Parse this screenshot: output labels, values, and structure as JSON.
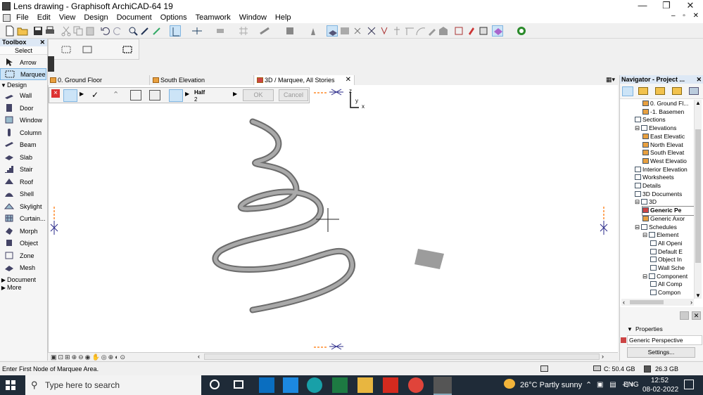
{
  "window": {
    "title": "Lens drawing - Graphisoft ArchiCAD-64 19",
    "controls": {
      "minimize": "—",
      "maximize": "❐",
      "close": "✕"
    }
  },
  "menu": [
    "File",
    "Edit",
    "View",
    "Design",
    "Document",
    "Options",
    "Teamwork",
    "Window",
    "Help"
  ],
  "toolbox": {
    "title": "Toolbox",
    "close": "✕",
    "select_label": "Select",
    "tools_top": [
      {
        "label": "Arrow",
        "icon": "arrow-icon"
      },
      {
        "label": "Marquee",
        "icon": "marquee-icon",
        "selected": true
      }
    ],
    "design_group": "Design",
    "design_tools": [
      {
        "label": "Wall",
        "icon": "wall-icon"
      },
      {
        "label": "Door",
        "icon": "door-icon"
      },
      {
        "label": "Window",
        "icon": "window-icon"
      },
      {
        "label": "Column",
        "icon": "column-icon"
      },
      {
        "label": "Beam",
        "icon": "beam-icon"
      },
      {
        "label": "Slab",
        "icon": "slab-icon"
      },
      {
        "label": "Stair",
        "icon": "stair-icon"
      },
      {
        "label": "Roof",
        "icon": "roof-icon"
      },
      {
        "label": "Shell",
        "icon": "shell-icon"
      },
      {
        "label": "Skylight",
        "icon": "skylight-icon"
      },
      {
        "label": "Curtain...",
        "icon": "curtain-wall-icon"
      },
      {
        "label": "Morph",
        "icon": "morph-icon"
      },
      {
        "label": "Object",
        "icon": "object-icon"
      },
      {
        "label": "Zone",
        "icon": "zone-icon"
      },
      {
        "label": "Mesh",
        "icon": "mesh-icon"
      }
    ],
    "document_group": "Document",
    "more_group": "More"
  },
  "tabs": [
    {
      "label": "0. Ground Floor"
    },
    {
      "label": "South Elevation"
    },
    {
      "label": "3D / Marquee, All Stories",
      "active": true,
      "close": "✕"
    }
  ],
  "marquee_bar": {
    "close": "×",
    "half_label": "Half",
    "half_value": "2",
    "ok_label": "OK",
    "cancel_label": "Cancel"
  },
  "axes": {
    "z": "z",
    "y": "y",
    "x": "x"
  },
  "navigator": {
    "title": "Navigator - Project ...",
    "close": "✕",
    "items": [
      {
        "label": "0. Ground Fl...",
        "indent": 2,
        "icon": "story-icon"
      },
      {
        "label": "-1. Basemen",
        "indent": 2,
        "icon": "story-icon"
      },
      {
        "label": "Sections",
        "indent": 1,
        "icon": "section-icon"
      },
      {
        "label": "Elevations",
        "indent": 1,
        "icon": "elevation-icon",
        "expander": "⊟"
      },
      {
        "label": "East Elevatic",
        "indent": 2,
        "icon": "house-icon"
      },
      {
        "label": "North Elevat",
        "indent": 2,
        "icon": "house-icon"
      },
      {
        "label": "South Elevat",
        "indent": 2,
        "icon": "house-icon"
      },
      {
        "label": "West Elevatio",
        "indent": 2,
        "icon": "house-icon"
      },
      {
        "label": "Interior Elevation",
        "indent": 1,
        "icon": "interior-elevation-icon"
      },
      {
        "label": "Worksheets",
        "indent": 1,
        "icon": "worksheet-icon"
      },
      {
        "label": "Details",
        "indent": 1,
        "icon": "detail-icon"
      },
      {
        "label": "3D Documents",
        "indent": 1,
        "icon": "3d-document-icon"
      },
      {
        "label": "3D",
        "indent": 1,
        "icon": "3d-icon",
        "expander": "⊟"
      },
      {
        "label": "Generic Pe",
        "indent": 2,
        "icon": "camera-icon",
        "selected": true
      },
      {
        "label": "Generic Axor",
        "indent": 2,
        "icon": "axon-icon"
      },
      {
        "label": "Schedules",
        "indent": 1,
        "icon": "schedule-icon",
        "expander": "⊟"
      },
      {
        "label": "Element",
        "indent": 2,
        "icon": "schedule-icon",
        "expander": "⊟"
      },
      {
        "label": "All Openi",
        "indent": 3,
        "icon": "schedule-icon"
      },
      {
        "label": "Default E",
        "indent": 3,
        "icon": "schedule-icon"
      },
      {
        "label": "Object In",
        "indent": 3,
        "icon": "schedule-icon"
      },
      {
        "label": "Wall Sche",
        "indent": 3,
        "icon": "schedule-icon"
      },
      {
        "label": "Component",
        "indent": 2,
        "icon": "schedule-icon",
        "expander": "⊟"
      },
      {
        "label": "All Comp",
        "indent": 3,
        "icon": "schedule-icon"
      },
      {
        "label": "Compon",
        "indent": 3,
        "icon": "schedule-icon"
      }
    ]
  },
  "properties": {
    "title": "Properties",
    "value": "Generic Perspective",
    "settings_label": "Settings..."
  },
  "status": {
    "prompt": "Enter First Node of Marquee Area.",
    "c_drive": "C: 50.4 GB",
    "memory": "26.3 GB"
  },
  "taskbar": {
    "search_placeholder": "Type here to search",
    "weather": "26°C  Partly sunny",
    "lang": "ENG",
    "time": "12:52",
    "date": "08-02-2022"
  },
  "colors": {
    "accent": "#cce4f7",
    "taskbar": "#1f2b38",
    "model_grey": "#8f8f8f",
    "axis_marker": "#ff8a2a"
  }
}
